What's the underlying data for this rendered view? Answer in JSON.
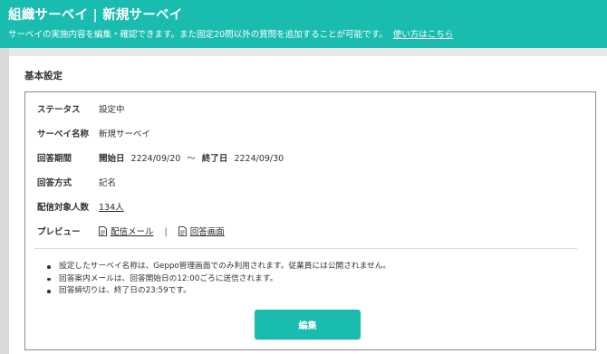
{
  "header": {
    "title": "組織サーベイ | 新規サーベイ",
    "description": "サーベイの実施内容を編集・確認できます。また固定20問以外の質問を追加することが可能です。",
    "help_link": "使い方はこちら"
  },
  "section": {
    "title": "基本設定"
  },
  "settings": {
    "status": {
      "label": "ステータス",
      "value": "設定中"
    },
    "name": {
      "label": "サーベイ名称",
      "value": "新規サーベイ"
    },
    "period": {
      "label": "回答期間",
      "start_label": "開始日",
      "start_date": "2224/09/20",
      "tilde": "〜",
      "end_label": "終了日",
      "end_date": "2224/09/30"
    },
    "method": {
      "label": "回答方式",
      "value": "記名"
    },
    "recipients": {
      "label": "配信対象人数",
      "value": "134人"
    },
    "preview": {
      "label": "プレビュー",
      "mail_link": "配信メール",
      "separator": "|",
      "screen_link": "回答画面"
    }
  },
  "notes": [
    "設定したサーベイ名称は、Geppo管理画面でのみ利用されます。従業員には公開されません。",
    "回答案内メールは、回答開始日の12:00ごろに送信されます。",
    "回答締切りは、終了日の23:59です。"
  ],
  "actions": {
    "edit_label": "編集"
  },
  "colors": {
    "accent": "#1bbcb0",
    "header_text": "#ffffff",
    "border": "#8a8a8a"
  }
}
